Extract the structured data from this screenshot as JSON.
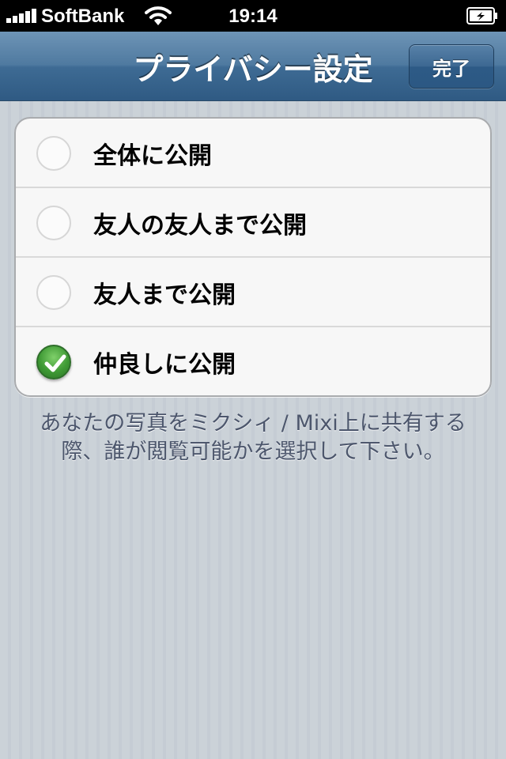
{
  "status_bar": {
    "carrier": "SoftBank",
    "time": "19:14"
  },
  "nav": {
    "title": "プライバシー設定",
    "done_label": "完了"
  },
  "options": [
    {
      "label": "全体に公開",
      "selected": false
    },
    {
      "label": "友人の友人まで公開",
      "selected": false
    },
    {
      "label": "友人まで公開",
      "selected": false
    },
    {
      "label": "仲良しに公開",
      "selected": true
    }
  ],
  "footer_text": "あなたの写真をミクシィ / Mixi上に共有する際、誰が閲覧可能かを選択して下さい。",
  "colors": {
    "nav_bar": "#4f7aa0",
    "selected_check": "#3f9a35",
    "background": "#c5ccd4"
  }
}
